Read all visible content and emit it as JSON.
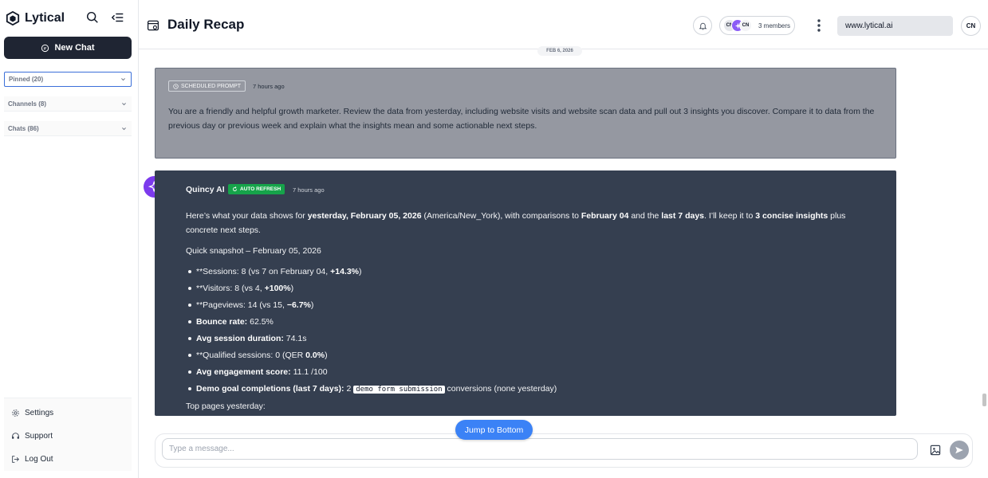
{
  "app": {
    "name": "Lytical"
  },
  "sidebar": {
    "new_chat_label": "New Chat",
    "sections": [
      {
        "label": "Pinned (20)"
      },
      {
        "label": "Channels (8)"
      },
      {
        "label": "Chats (86)"
      }
    ],
    "bottom": [
      {
        "label": "Settings",
        "icon": "gear-icon"
      },
      {
        "label": "Support",
        "icon": "headset-icon"
      },
      {
        "label": "Log Out",
        "icon": "logout-icon"
      }
    ]
  },
  "header": {
    "title": "Daily Recap",
    "members": {
      "avatars": [
        "CN",
        "CN"
      ],
      "label": "3 members"
    },
    "url": "www.lytical.ai",
    "user_initials": "CN"
  },
  "conversation": {
    "date_divider": "FEB 6, 2026",
    "prompt": {
      "badge": "SCHEDULED PROMPT",
      "time": "7 hours ago",
      "text": "You are a friendly and helpful growth marketer. Review the data from yesterday, including website visits and website scan data and pull out 3 insights you discover. Compare it to data from the previous day or previous week and explain what the insights mean and some actionable next steps."
    },
    "ai": {
      "name": "Quincy AI",
      "badge": "AUTO REFRESH",
      "time": "7 hours ago",
      "intro": {
        "t1": "Here’s what your data shows for ",
        "b1": "yesterday, February 05, 2026",
        "t2": " (America/New_York), with comparisons to ",
        "b2": "February 04",
        "t3": " and the ",
        "b3": "last 7 days",
        "t4": ". I’ll keep it to ",
        "b4": "3 concise insights",
        "t5": " plus concrete next steps."
      },
      "snapshot_heading": "Quick snapshot – February 05, 2026",
      "bullets": {
        "sessions": {
          "pre": "**Sessions: 8 (vs 7 on February 04, ",
          "bold": "+14.3%",
          "post": ")"
        },
        "visitors": {
          "pre": "**Visitors: 8 (vs 4, ",
          "bold": "+100%",
          "post": ")"
        },
        "pageviews": {
          "pre": "**Pageviews: 14 (vs 15, ",
          "bold": "−6.7%",
          "post": ")"
        },
        "bounce": {
          "bold": "Bounce rate:",
          "post": " 62.5%"
        },
        "duration": {
          "bold": "Avg session duration:",
          "post": " 74.1s"
        },
        "qualified": {
          "pre": "**Qualified sessions: 0 (QER ",
          "bold": "0.0%",
          "post": ")"
        },
        "engagement": {
          "bold": "Avg engagement score:",
          "post": " 11.1 /100"
        },
        "demo": {
          "bold": "Demo goal completions (last 7 days):",
          "mid": " 2 ",
          "code": "demo form submission",
          "post": " conversions (none yesterday)"
        }
      },
      "top_pages_heading": "Top pages yesterday:"
    }
  },
  "composer": {
    "placeholder": "Type a message...",
    "jump_label": "Jump to Bottom"
  }
}
